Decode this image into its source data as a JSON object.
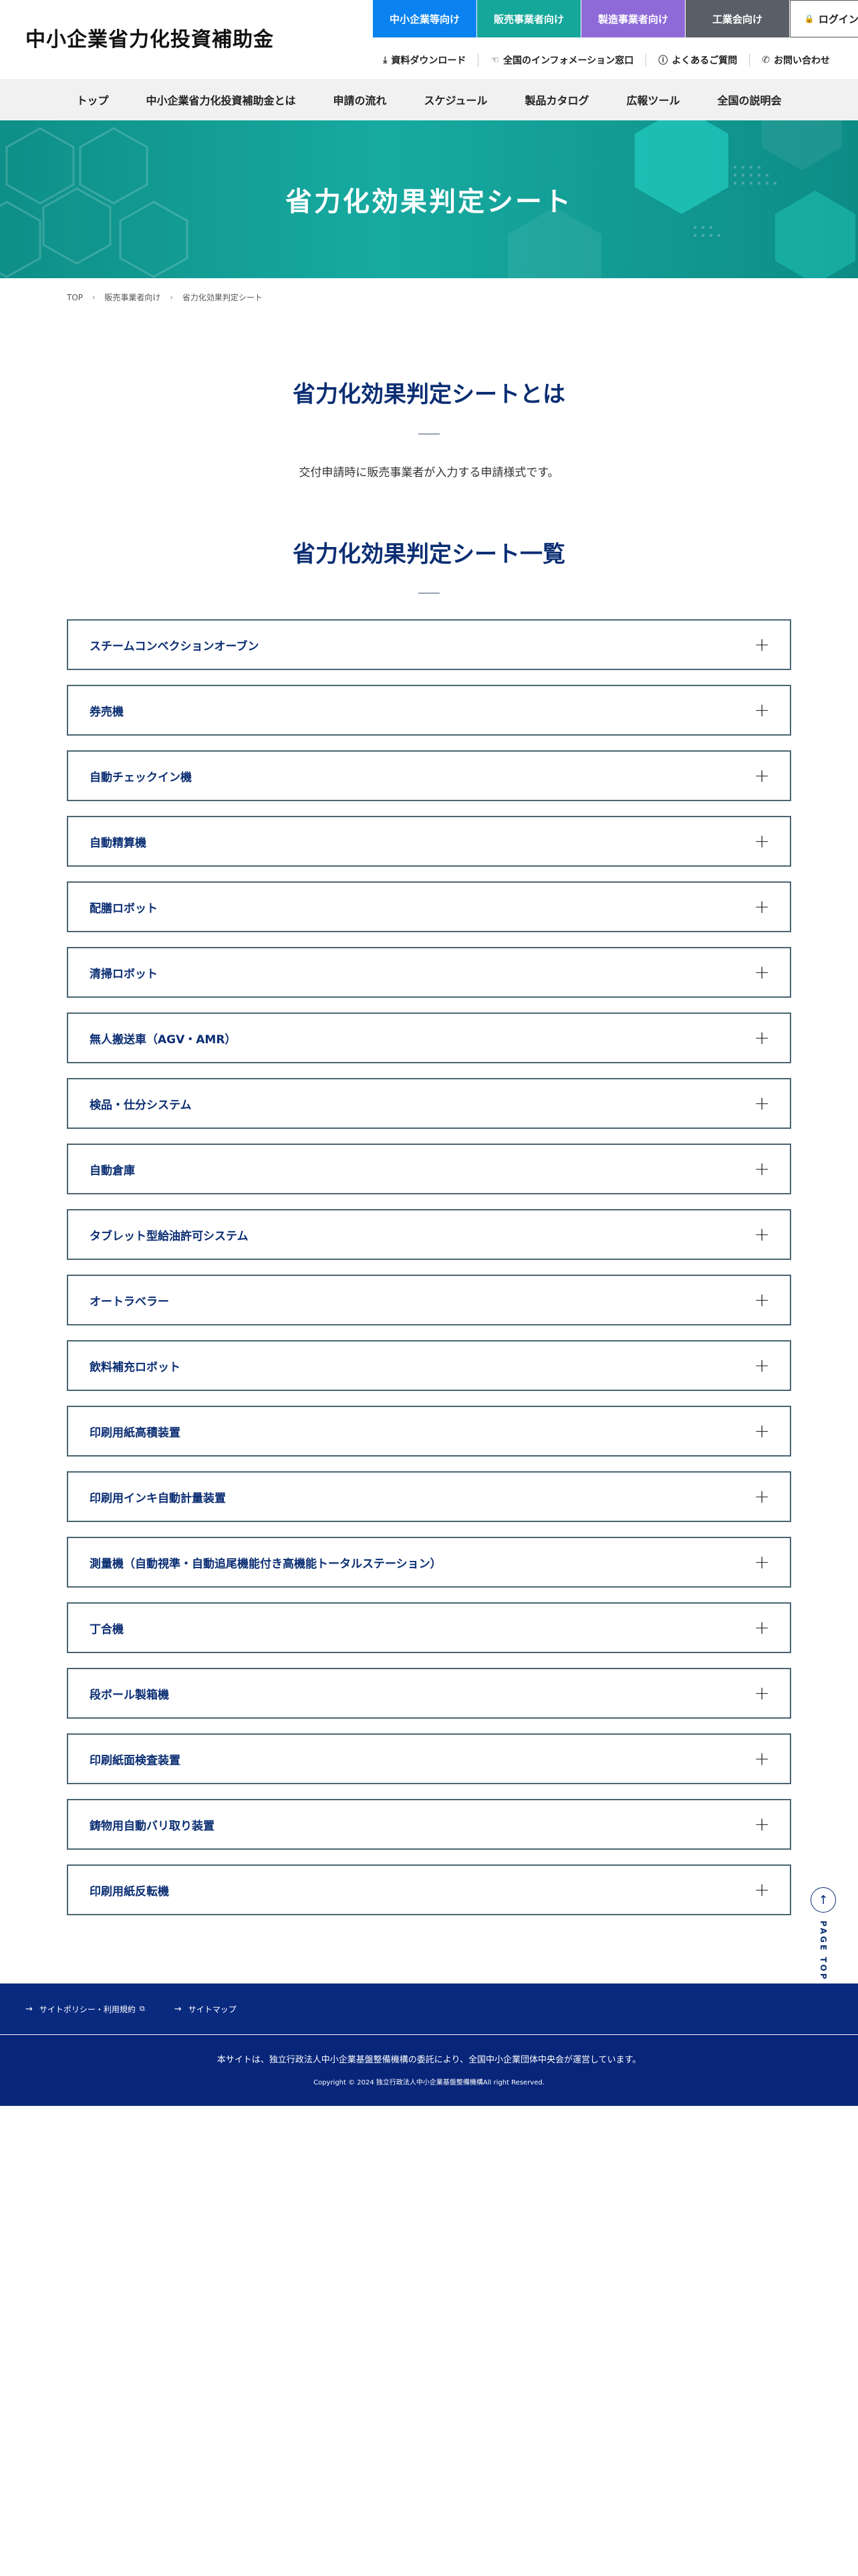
{
  "header": {
    "site_title": "中小企業省力化投資補助金",
    "audience_tabs": [
      "中小企業等向け",
      "販売事業者向け",
      "製造事業者向け",
      "工業会向け"
    ],
    "login_label": "ログイン",
    "util_links": [
      "資料ダウンロード",
      "全国のインフォメーション窓口",
      "よくあるご質問",
      "お問い合わせ"
    ]
  },
  "gnav": {
    "items": [
      "トップ",
      "中小企業省力化投資補助金とは",
      "申請の流れ",
      "スケジュール",
      "製品カタログ",
      "広報ツール",
      "全国の説明会"
    ]
  },
  "hero": {
    "title": "省力化効果判定シート"
  },
  "breadcrumb": {
    "items": [
      "TOP",
      "販売事業者向け",
      "省力化効果判定シート"
    ]
  },
  "about": {
    "title": "省力化効果判定シートとは",
    "lead": "交付申請時に販売事業者が入力する申請様式です。"
  },
  "list": {
    "title": "省力化効果判定シート一覧",
    "items": [
      "スチームコンベクションオーブン",
      "券売機",
      "自動チェックイン機",
      "自動精算機",
      "配膳ロボット",
      "清掃ロボット",
      "無人搬送車（AGV・AMR）",
      "検品・仕分システム",
      "自動倉庫",
      "タブレット型給油許可システム",
      "オートラベラー",
      "飲料補充ロボット",
      "印刷用紙高積装置",
      "印刷用インキ自動計量装置",
      "測量機（自動視準・自動追尾機能付き高機能トータルステーション）",
      "丁合機",
      "段ボール製箱機",
      "印刷紙面検査装置",
      "鋳物用自動バリ取り装置",
      "印刷用紙反転機"
    ]
  },
  "page_top": {
    "label": "PAGE TOP"
  },
  "footer": {
    "links": [
      "サイトポリシー・利用規約",
      "サイトマップ"
    ],
    "note": "本サイトは、独立行政法人中小企業基盤整備機構の委託により、全国中小企業団体中央会が運営しています。",
    "copyright": "Copyright © 2024 独立行政法人中小企業基盤整備機構All right Reserved."
  },
  "colors": {
    "sme_tab": "#0a82f0",
    "vendor_tab": "#14a79a",
    "maker_tab": "#8e6ad8",
    "union_tab": "#5a5e66",
    "heading_navy": "#0b2e73",
    "hero_teal": "#14a79a",
    "footer_navy": "#0a2a80"
  },
  "icons": {
    "login": "lock-icon",
    "login_caret": "chevron-down-icon",
    "util": [
      "download-icon",
      "pointer-icon",
      "question-icon",
      "phone-icon"
    ],
    "accordion": "plus-icon",
    "page_top": "arrow-up-icon",
    "footer_link": "arrow-right-icon",
    "external": "external-link-icon"
  }
}
